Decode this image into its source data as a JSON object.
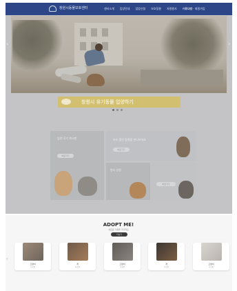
{
  "header": {
    "brand": "창원시동물보호센터",
    "menu": [
      "센터소개",
      "입양안내",
      "입양신청",
      "보호동물",
      "자원봉사",
      "커뮤니티"
    ],
    "login": "로그인 · 회원가입"
  },
  "banner": {
    "text": "창원시 유기동물 입양하기"
  },
  "cards": {
    "main_title": "입양 후기 게시판",
    "main_pill": "바로가기",
    "top_right_title": "보호 중인 동물을 만나보세요",
    "top_right_pill": "바로가기",
    "bottom_mid_title": "봉사 신청",
    "bottom_right_pill": "바로가기"
  },
  "adopt": {
    "title": "ADOPT ME!",
    "subtitle": "새로운 가족을 기다려요",
    "button": "더보기",
    "pets": [
      {
        "label": "고양이",
        "meta": "보호중"
      },
      {
        "label": "개",
        "meta": "보호중"
      },
      {
        "label": "고양이",
        "meta": "보호중"
      },
      {
        "label": "개",
        "meta": "보호중"
      },
      {
        "label": "고양이",
        "meta": "보호중"
      }
    ]
  },
  "icons": {
    "prev": "‹",
    "next": "›"
  }
}
